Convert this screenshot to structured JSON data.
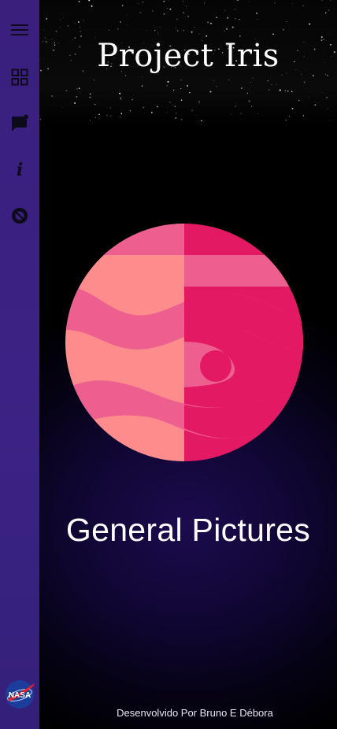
{
  "header": {
    "title": "Project Iris"
  },
  "main": {
    "section_title": "General Pictures"
  },
  "footer": {
    "credit": "Desenvolvido Por Bruno E Débora"
  },
  "sidebar": {
    "items": [
      {
        "icon": "menu-icon"
      },
      {
        "icon": "grid-icon"
      },
      {
        "icon": "feedback-icon"
      },
      {
        "icon": "info-icon"
      },
      {
        "icon": "no-sign-icon"
      }
    ],
    "logo_text": "NASA"
  },
  "colors": {
    "sidebar": "#3a1f7d",
    "planet_light": "#fe8c8c",
    "planet_mid": "#ec5f8f",
    "planet_dark": "#e31a63"
  }
}
